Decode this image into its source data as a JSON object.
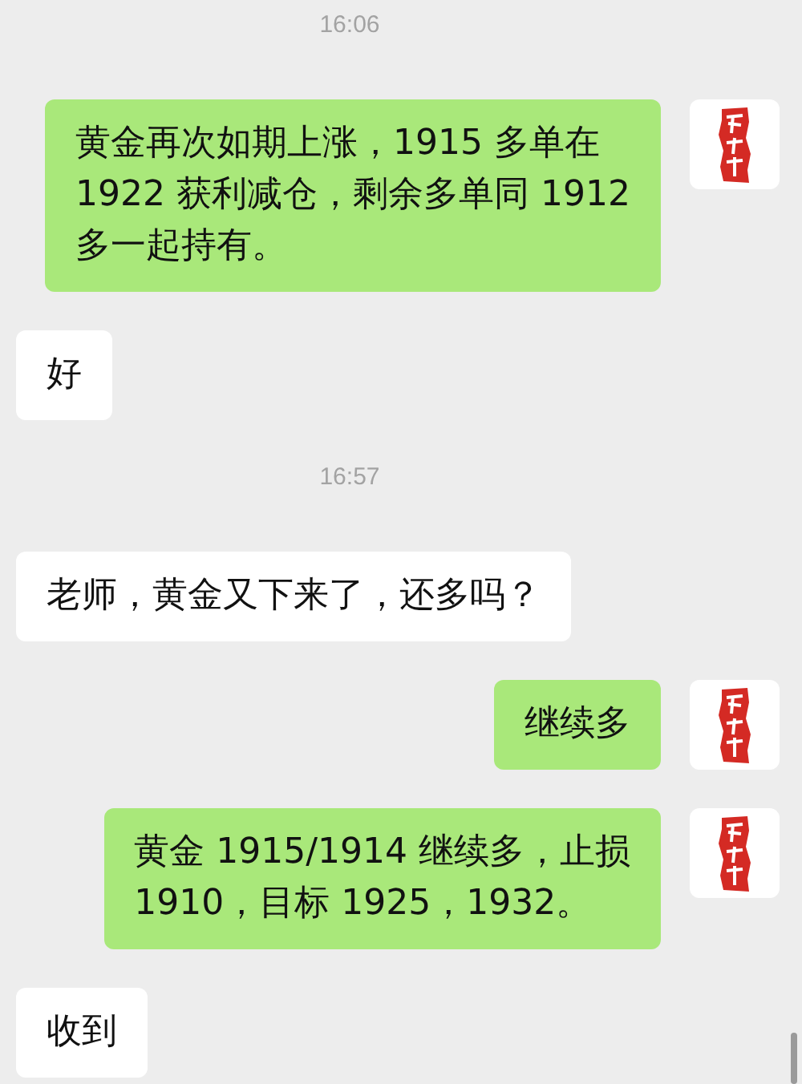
{
  "messages": [
    {
      "kind": "time",
      "text": "16:06"
    },
    {
      "kind": "message",
      "outgoing": true,
      "lines": [
        "黄金再次如期上涨，1915 多单在",
        "1922 获利减仓，剩余多单同 1912",
        "多一起持有。"
      ]
    },
    {
      "kind": "message",
      "outgoing": false,
      "lines": [
        "好"
      ]
    },
    {
      "kind": "time",
      "text": "16:57"
    },
    {
      "kind": "message",
      "outgoing": false,
      "lines": [
        "老师，黄金又下来了，还多吗？"
      ]
    },
    {
      "kind": "message",
      "outgoing": true,
      "lines": [
        "继续多"
      ]
    },
    {
      "kind": "message",
      "outgoing": true,
      "lines": [
        "黄金 1915/1914 继续多，止损",
        "1910，目标 1925，1932。"
      ]
    },
    {
      "kind": "message",
      "outgoing": false,
      "lines": [
        "收到"
      ]
    }
  ]
}
